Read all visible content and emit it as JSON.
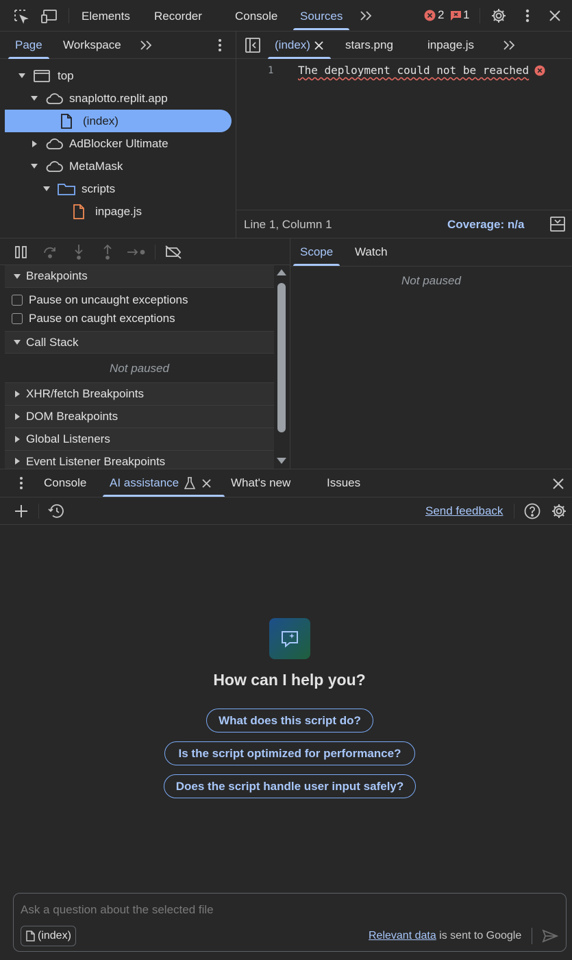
{
  "top_toolbar": {
    "tabs": [
      "Elements",
      "Recorder",
      "Console",
      "Sources"
    ],
    "active_tab": "Sources",
    "error_count": "2",
    "message_count": "1",
    "icons": [
      "inspect-element-icon",
      "device-toolbar-icon",
      "more-tabs-icon",
      "error-icon",
      "message-icon",
      "settings-icon",
      "kebab-menu-icon",
      "close-icon"
    ]
  },
  "navigator": {
    "tabs": [
      "Page",
      "Workspace"
    ],
    "active_tab": "Page",
    "tree": [
      {
        "label": "top",
        "icon": "frame-icon",
        "expanded": true
      },
      {
        "label": "snaplotto.replit.app",
        "icon": "cloud-icon",
        "expanded": true
      },
      {
        "label": "(index)",
        "icon": "file-icon",
        "selected": true
      },
      {
        "label": "AdBlocker Ultimate",
        "icon": "cloud-icon",
        "expanded": false
      },
      {
        "label": "MetaMask",
        "icon": "cloud-icon",
        "expanded": true
      },
      {
        "label": "scripts",
        "icon": "folder-icon",
        "expanded": true
      },
      {
        "label": "inpage.js",
        "icon": "js-file-icon"
      }
    ]
  },
  "editor": {
    "tabs": [
      "(index)",
      "stars.png",
      "inpage.js"
    ],
    "active_tab": "(index)",
    "line_number": "1",
    "code_line": "The deployment could not be reached",
    "status_position": "Line 1, Column 1",
    "coverage": "Coverage: n/a"
  },
  "debugger": {
    "sections": {
      "breakpoints": "Breakpoints",
      "pause_uncaught": "Pause on uncaught exceptions",
      "pause_caught": "Pause on caught exceptions",
      "call_stack": "Call Stack",
      "call_stack_status": "Not paused",
      "xhr": "XHR/fetch Breakpoints",
      "dom": "DOM Breakpoints",
      "global": "Global Listeners",
      "event": "Event Listener Breakpoints"
    },
    "scope_tabs": [
      "Scope",
      "Watch"
    ],
    "active_scope_tab": "Scope",
    "scope_status": "Not paused"
  },
  "drawer": {
    "tabs": [
      "Console",
      "AI assistance",
      "What's new",
      "Issues"
    ],
    "active_tab": "AI assistance",
    "send_feedback": "Send feedback",
    "greeting": "How can I help you?",
    "suggestions": [
      "What does this script do?",
      "Is the script optimized for performance?",
      "Does the script handle user input safely?"
    ],
    "input_placeholder": "Ask a question about the selected file",
    "context_chip": "(index)",
    "disclaimer_link": "Relevant data",
    "disclaimer_text": " is sent to Google"
  },
  "colors": {
    "accent": "#a8c7fa",
    "selection": "#7cacf8",
    "error": "#e46962",
    "background": "#282828",
    "js_file": "#f28b54",
    "folder": "#7cacf8"
  }
}
